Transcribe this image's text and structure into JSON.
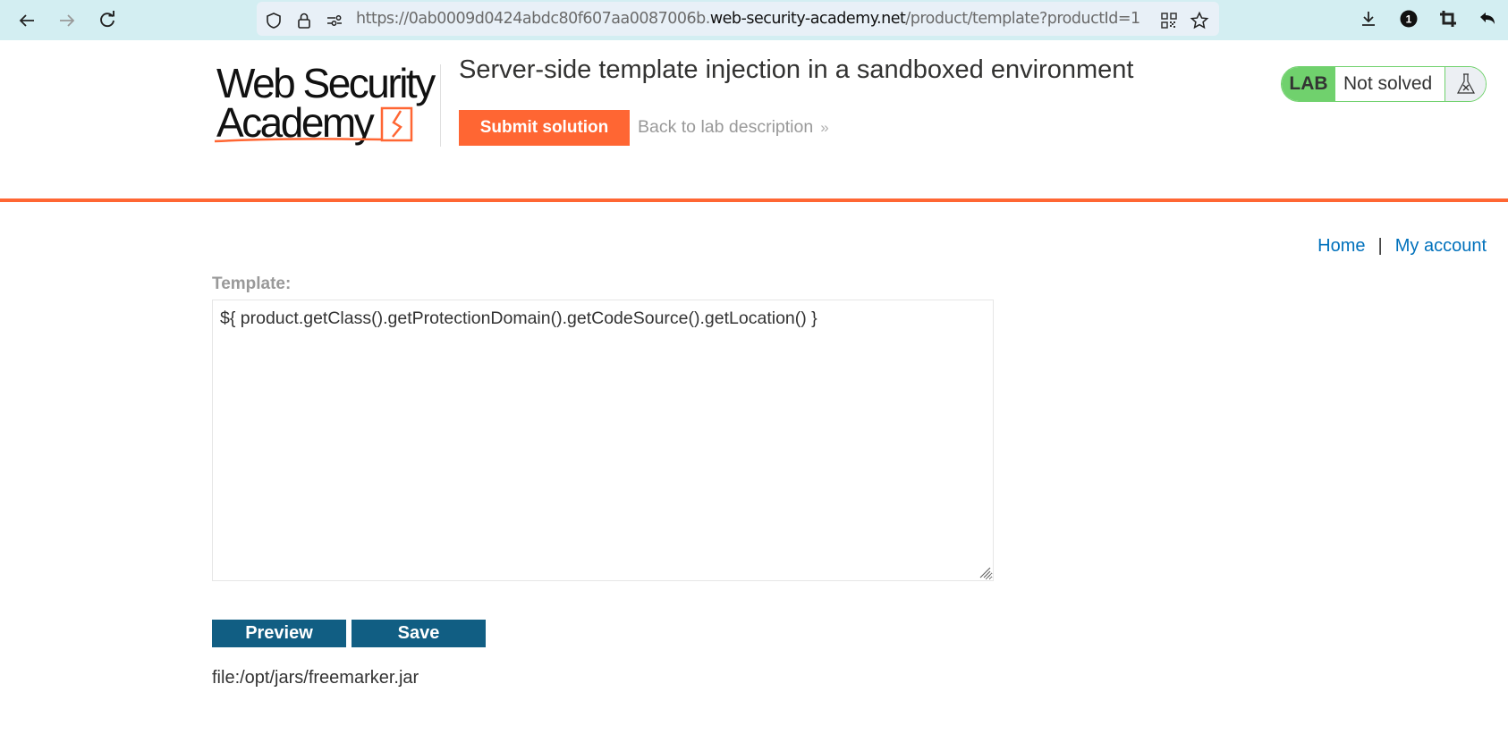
{
  "browser": {
    "url_prefix": "https://0ab0009d0424abdc80f607aa0087006b.",
    "url_domain": "web-security-academy.net",
    "url_path": "/product/template?productId=1",
    "notification_count": "1",
    "icons": {
      "back": "arrow-left-icon",
      "forward": "arrow-right-icon",
      "reload": "reload-icon",
      "shield": "shield-icon",
      "lock": "lock-icon",
      "permissions": "sliders-icon",
      "qr": "qr-code-icon",
      "bookmark": "star-icon",
      "download": "download-icon",
      "crop": "crop-icon",
      "undo": "undo-icon"
    }
  },
  "header": {
    "logo_line1": "Web Security",
    "logo_line2": "Academy",
    "title": "Server-side template injection in a sandboxed environment",
    "submit_label": "Submit solution",
    "back_label": "Back to lab description",
    "back_chevron": "»",
    "lab_badge": {
      "tag": "LAB",
      "status": "Not solved",
      "icon": "flask-icon"
    }
  },
  "colors": {
    "accent_orange": "#ff6633",
    "lab_green": "#70d16d",
    "button_blue": "#115e83",
    "link_blue": "#0071bc"
  },
  "nav": {
    "home": "Home",
    "separator": "|",
    "my_account": "My account"
  },
  "editor": {
    "label": "Template:",
    "value": "${ product.getClass().getProtectionDomain().getCodeSource().getLocation() }",
    "preview_label": "Preview",
    "save_label": "Save"
  },
  "result": {
    "output": "file:/opt/jars/freemarker.jar"
  }
}
